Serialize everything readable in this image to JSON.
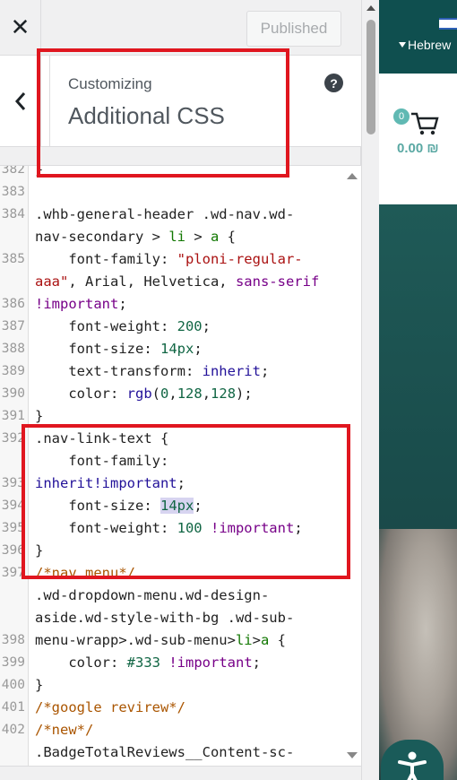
{
  "topbar": {
    "close_glyph": "✕",
    "publish_label": "Published"
  },
  "section": {
    "customizing_label": "Customizing",
    "title": "Additional CSS",
    "help_glyph": "?"
  },
  "editor": {
    "line_numbers": [
      "382",
      "383",
      "384",
      "",
      "385",
      "",
      "386",
      "387",
      "388",
      "389",
      "390",
      "391",
      "392",
      "",
      "393",
      "394",
      "395",
      "396",
      "397",
      "",
      "",
      "398",
      "399",
      "400",
      "401",
      "402"
    ],
    "lines": [
      [
        {
          "t": "}",
          "c": ""
        }
      ],
      [
        {
          "t": "",
          "c": ""
        }
      ],
      [
        {
          "t": ".whb-general-header .wd-nav.wd-",
          "c": ""
        }
      ],
      [
        {
          "t": "nav-secondary > ",
          "c": ""
        },
        {
          "t": "li",
          "c": "tag"
        },
        {
          "t": " > ",
          "c": ""
        },
        {
          "t": "a",
          "c": "tag"
        },
        {
          "t": " {",
          "c": ""
        }
      ],
      [
        {
          "t": "    font-family: ",
          "c": ""
        },
        {
          "t": "\"ploni-regular-",
          "c": "str"
        }
      ],
      [
        {
          "t": "aaa\"",
          "c": "str"
        },
        {
          "t": ", Arial, Helvetica, ",
          "c": ""
        },
        {
          "t": "sans-serif",
          "c": "imp"
        }
      ],
      [
        {
          "t": "!important",
          "c": "imp"
        },
        {
          "t": ";",
          "c": ""
        }
      ],
      [
        {
          "t": "    font-weight: ",
          "c": ""
        },
        {
          "t": "200",
          "c": "num"
        },
        {
          "t": ";",
          "c": ""
        }
      ],
      [
        {
          "t": "    font-size: ",
          "c": ""
        },
        {
          "t": "14px",
          "c": "num"
        },
        {
          "t": ";",
          "c": ""
        }
      ],
      [
        {
          "t": "    text-transform: ",
          "c": ""
        },
        {
          "t": "inherit",
          "c": "atom"
        },
        {
          "t": ";",
          "c": ""
        }
      ],
      [
        {
          "t": "    color: ",
          "c": ""
        },
        {
          "t": "rgb",
          "c": "atom"
        },
        {
          "t": "(",
          "c": ""
        },
        {
          "t": "0",
          "c": "num"
        },
        {
          "t": ",",
          "c": ""
        },
        {
          "t": "128",
          "c": "num"
        },
        {
          "t": ",",
          "c": ""
        },
        {
          "t": "128",
          "c": "num"
        },
        {
          "t": ");",
          "c": ""
        }
      ],
      [
        {
          "t": "}",
          "c": ""
        }
      ],
      [
        {
          "t": ".nav-link-text {",
          "c": ""
        }
      ],
      [
        {
          "t": "    font-family:",
          "c": ""
        }
      ],
      [
        {
          "t": "inherit!important",
          "c": "atom"
        },
        {
          "t": ";",
          "c": ""
        }
      ],
      [
        {
          "t": "    font-size: ",
          "c": ""
        },
        {
          "t": "14px",
          "c": "num sel"
        },
        {
          "t": ";",
          "c": ""
        }
      ],
      [
        {
          "t": "    font-weight: ",
          "c": ""
        },
        {
          "t": "100",
          "c": "num"
        },
        {
          "t": " ",
          "c": ""
        },
        {
          "t": "!important",
          "c": "imp"
        },
        {
          "t": ";",
          "c": ""
        }
      ],
      [
        {
          "t": "}",
          "c": ""
        }
      ],
      [
        {
          "t": "/*nav menu*/",
          "c": "cmt"
        }
      ],
      [
        {
          "t": ".wd-dropdown-menu.wd-design-",
          "c": ""
        }
      ],
      [
        {
          "t": "aside.wd-style-with-bg .wd-sub-",
          "c": ""
        }
      ],
      [
        {
          "t": "menu-wrapp>.wd-sub-menu>",
          "c": ""
        },
        {
          "t": "li",
          "c": "tag"
        },
        {
          "t": ">",
          "c": ""
        },
        {
          "t": "a",
          "c": "tag"
        },
        {
          "t": " {",
          "c": ""
        }
      ],
      [
        {
          "t": "    color: ",
          "c": ""
        },
        {
          "t": "#333",
          "c": "num"
        },
        {
          "t": " ",
          "c": ""
        },
        {
          "t": "!important",
          "c": "imp"
        },
        {
          "t": ";",
          "c": ""
        }
      ],
      [
        {
          "t": "}",
          "c": ""
        }
      ],
      [
        {
          "t": "/*google revirew*/",
          "c": "cmt"
        }
      ],
      [
        {
          "t": "/*new*/",
          "c": "cmt"
        }
      ],
      [
        {
          "t": ".BadgeTotalReviews__Content-sc-",
          "c": ""
        }
      ]
    ]
  },
  "preview": {
    "language": "Hebrew",
    "cart_count": "0",
    "cart_total": "0.00 ₪"
  },
  "colors": {
    "highlight_box": "#e0161f",
    "brand_teal": "#0f4f4f",
    "accent_teal": "#60b9b3"
  },
  "icons": [
    "close-icon",
    "chevron-left-icon",
    "help-icon",
    "cart-icon",
    "accessibility-icon",
    "flag-icon"
  ]
}
